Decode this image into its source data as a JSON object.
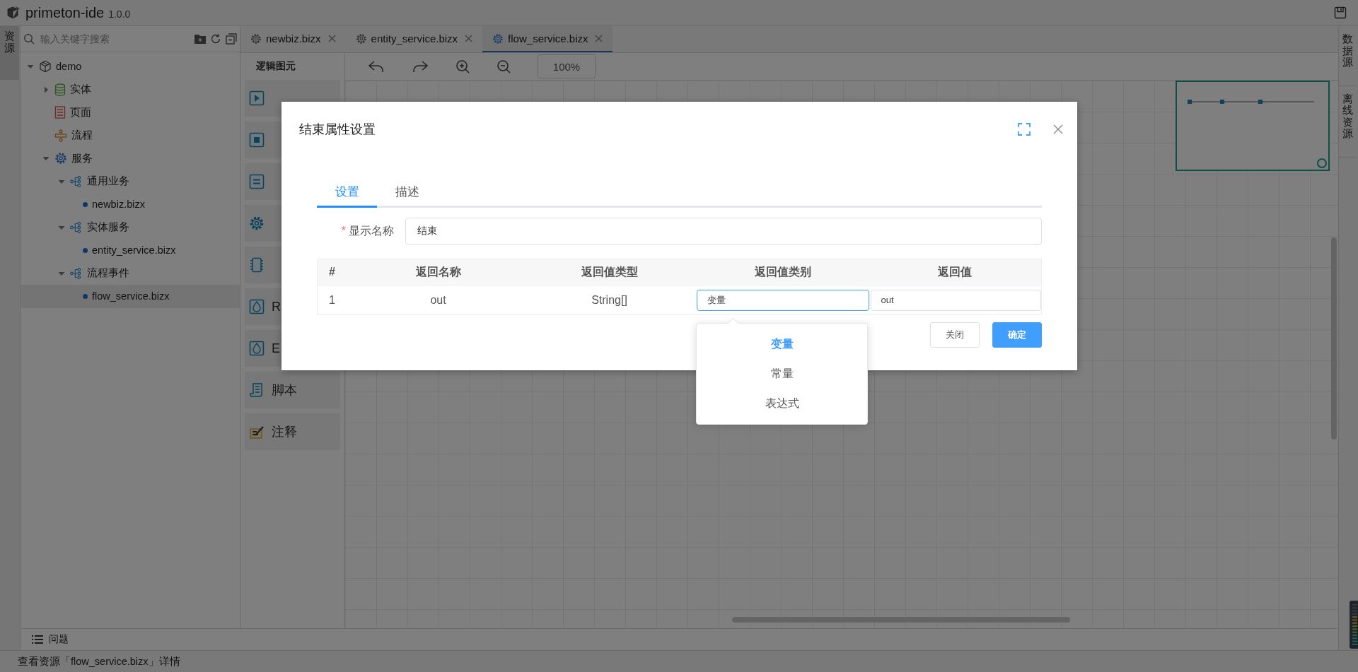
{
  "app": {
    "name": "primeton-ide",
    "version": "1.0.0"
  },
  "left_rail": [
    {
      "label": "资源",
      "selected": true
    }
  ],
  "explorer": {
    "search": {
      "placeholder": "输入关键字搜索"
    },
    "tree": [
      {
        "label": "demo",
        "kind": "project",
        "expanded": true,
        "selected": false,
        "children": [
          {
            "label": "实体",
            "kind": "entity",
            "expanded": false,
            "selected": false
          },
          {
            "label": "页面",
            "kind": "page",
            "selected": false
          },
          {
            "label": "流程",
            "kind": "flow",
            "selected": false
          },
          {
            "label": "服务",
            "kind": "service",
            "expanded": true,
            "selected": false,
            "children": [
              {
                "label": "通用业务",
                "kind": "group",
                "expanded": true,
                "selected": false,
                "children": [
                  {
                    "label": "newbiz.bizx",
                    "kind": "file",
                    "selected": false
                  }
                ]
              },
              {
                "label": "实体服务",
                "kind": "group",
                "expanded": true,
                "selected": false,
                "children": [
                  {
                    "label": "entity_service.bizx",
                    "kind": "file",
                    "selected": false
                  }
                ]
              },
              {
                "label": "流程事件",
                "kind": "group",
                "expanded": true,
                "selected": false,
                "children": [
                  {
                    "label": "flow_service.bizx",
                    "kind": "file",
                    "selected": true
                  }
                ]
              }
            ]
          }
        ]
      }
    ]
  },
  "editor_tabs": [
    {
      "label": "newbiz.bizx",
      "selected": false
    },
    {
      "label": "entity_service.bizx",
      "selected": false
    },
    {
      "label": "flow_service.bizx",
      "selected": true
    }
  ],
  "palette": {
    "title": "逻辑图元",
    "items": [
      {
        "kind": "start"
      },
      {
        "kind": "end"
      },
      {
        "kind": "assign"
      },
      {
        "kind": "logic"
      },
      {
        "kind": "chip"
      },
      {
        "label": "R",
        "kind": "r"
      },
      {
        "label": "E",
        "kind": "e"
      },
      {
        "label": "脚本",
        "kind": "script"
      },
      {
        "label": "注释",
        "kind": "note"
      }
    ]
  },
  "toolbar": {
    "zoom": "100%"
  },
  "right_rail": [
    {
      "label": "数据源"
    },
    {
      "label": "离线资源"
    }
  ],
  "bottom_panel": {
    "label": "问题"
  },
  "status_bar": "查看资源「flow_service.bizx」详情",
  "dialog": {
    "title": "结束属性设置",
    "tabs": [
      {
        "label": "设置",
        "selected": true
      },
      {
        "label": "描述",
        "selected": false
      }
    ],
    "display_name": {
      "label": "显示名称",
      "required_mark": "*",
      "value": "结束"
    },
    "table": {
      "columns": [
        "#",
        "返回名称",
        "返回值类型",
        "返回值类别",
        "返回值"
      ],
      "rows": [
        {
          "index": "1",
          "name": "out",
          "type": "String[]",
          "category": "变量",
          "value": "out",
          "open": true
        }
      ]
    },
    "dropdown": [
      {
        "label": "变量",
        "selected": true
      },
      {
        "label": "常量",
        "selected": false
      },
      {
        "label": "表达式",
        "selected": false
      }
    ],
    "buttons": [
      {
        "label": "关闭",
        "kind": "default"
      },
      {
        "label": "确定",
        "kind": "primary"
      }
    ]
  }
}
